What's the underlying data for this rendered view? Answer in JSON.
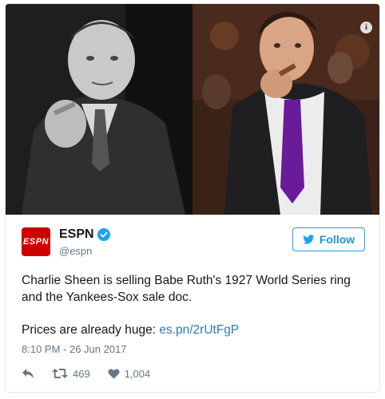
{
  "tweet": {
    "display_name": "ESPN",
    "handle": "@espn",
    "avatar_text": "ESPN",
    "follow_label": "Follow",
    "text_line1": "Charlie Sheen is selling Babe Ruth's 1927 World Series ring",
    "text_line2": "and the Yankees-Sox sale doc.",
    "text_line3_prefix": "Prices are already huge: ",
    "link_text": "es.pn/2rUtFgP",
    "timestamp": "8:10 PM - 26 Jun 2017",
    "retweet_count": "469",
    "like_count": "1,004",
    "info_icon_glyph": "i"
  },
  "colors": {
    "brand_blue": "#1da1f2",
    "link_blue": "#2b7bb9",
    "espn_red": "#cc0000",
    "muted_gray": "#657786"
  },
  "icons": [
    "info-icon",
    "verified-badge-icon",
    "twitter-bird-icon",
    "reply-icon",
    "retweet-icon",
    "heart-icon"
  ]
}
